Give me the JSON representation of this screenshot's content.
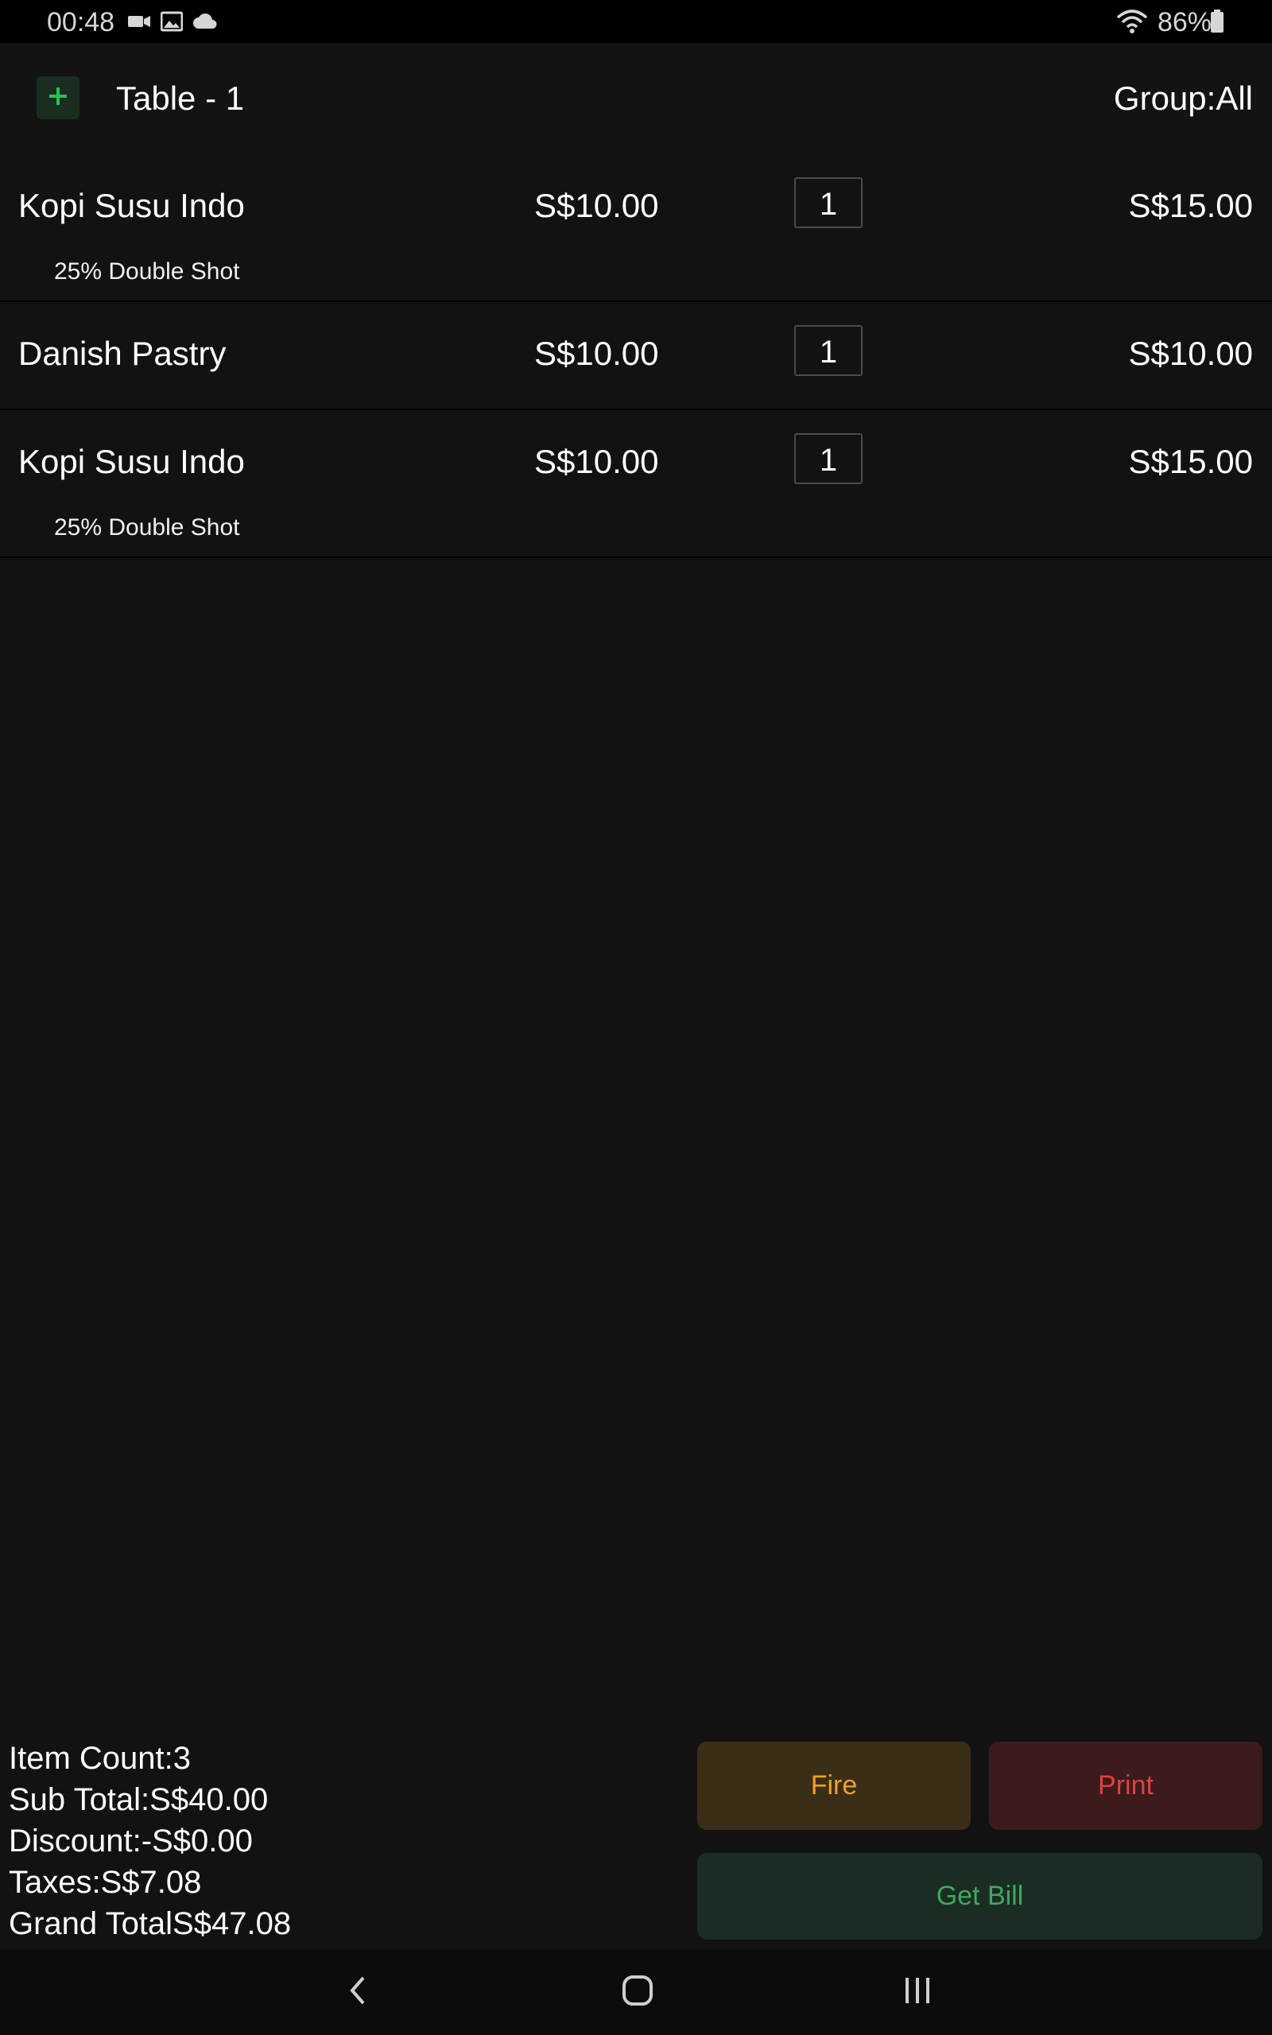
{
  "status_bar": {
    "time": "00:48",
    "battery_percent": "86%",
    "icons": [
      "video-icon",
      "image-icon",
      "cloud-icon",
      "wifi-icon",
      "battery-icon"
    ]
  },
  "header": {
    "add_icon": "plus-icon",
    "table_title": "Table - 1",
    "group_label": "Group:All"
  },
  "order_items": [
    {
      "name": "Kopi Susu Indo",
      "price": "S$10.00",
      "qty": "1",
      "total": "S$15.00",
      "modifier": "25% Double Shot"
    },
    {
      "name": "Danish Pastry",
      "price": "S$10.00",
      "qty": "1",
      "total": "S$10.00",
      "modifier": ""
    },
    {
      "name": "Kopi Susu Indo",
      "price": "S$10.00",
      "qty": "1",
      "total": "S$15.00",
      "modifier": "25% Double Shot"
    }
  ],
  "summary": {
    "item_count": "Item Count:3",
    "sub_total": "Sub Total:S$40.00",
    "discount": "Discount:-S$0.00",
    "taxes": "Taxes:S$7.08",
    "grand_total": "Grand TotalS$47.08"
  },
  "actions": {
    "fire_label": "Fire",
    "print_label": "Print",
    "get_bill_label": "Get Bill"
  },
  "nav": {
    "icons": [
      "back-icon",
      "home-icon",
      "recents-icon"
    ]
  },
  "colors": {
    "background": "#121212",
    "fire_text": "#f0a02a",
    "print_text": "#e0413f",
    "bill_text": "#3fa85f",
    "add_icon": "#2fbf5a"
  }
}
